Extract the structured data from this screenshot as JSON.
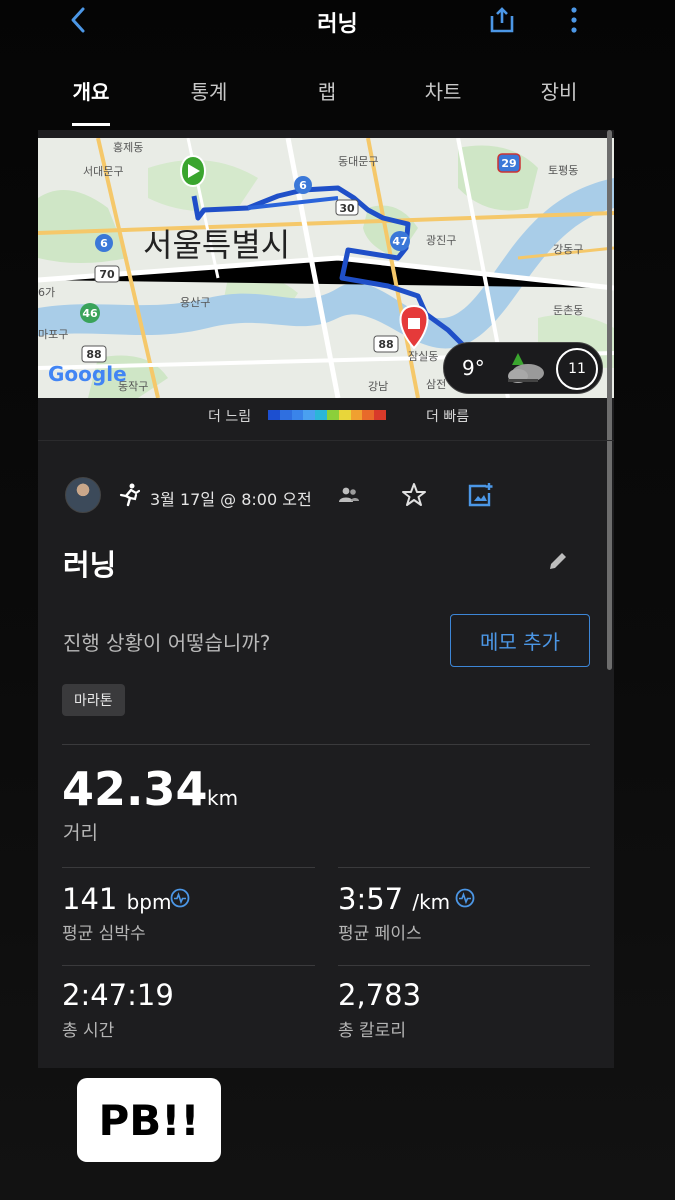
{
  "header": {
    "title": "러닝",
    "back_icon": "chevron-left-icon",
    "share_icon": "share-icon",
    "more_icon": "more-vertical-icon"
  },
  "tabs": [
    {
      "label": "개요",
      "active": true
    },
    {
      "label": "통계",
      "active": false
    },
    {
      "label": "랩",
      "active": false
    },
    {
      "label": "차트",
      "active": false
    },
    {
      "label": "장비",
      "active": false
    }
  ],
  "map": {
    "city_label": "서울특별시",
    "district_labels": [
      "홍제동",
      "서대문구",
      "동대문구",
      "광진구",
      "용산구",
      "잠실동",
      "강동구",
      "둔촌동",
      "토평동",
      "동작구",
      "삼전",
      "강남",
      "마포구",
      "6가"
    ],
    "route_markers": [
      "6",
      "30",
      "47",
      "6",
      "70",
      "46",
      "88",
      "88",
      "29"
    ],
    "provider": "Google",
    "weather": {
      "temperature": "9°",
      "wind": "11"
    }
  },
  "pace_legend": {
    "slow": "더 느림",
    "fast": "더 빠름",
    "colors": [
      "#1c4fd0",
      "#2f6fe0",
      "#3a84ea",
      "#4aa0f0",
      "#2bb6d8",
      "#8ccf3a",
      "#e8d63a",
      "#f0a030",
      "#e86a2a",
      "#d83a2a"
    ]
  },
  "activity": {
    "date": "3월 17일 @ 8:00 오전",
    "title": "러닝",
    "progress_question": "진행 상황이 어떻습니까?",
    "memo_button": "메모 추가",
    "tag": "마라톤"
  },
  "stats": {
    "distance": {
      "value": "42.34",
      "unit": "km",
      "label": "거리"
    },
    "heart_rate": {
      "value": "141",
      "unit": "bpm",
      "label": "평균 심박수"
    },
    "pace": {
      "value": "3:57",
      "unit": "/km",
      "label": "평균 페이스"
    },
    "time": {
      "value": "2:47:19",
      "label": "총 시간"
    },
    "calories": {
      "value": "2,783",
      "label": "총 칼로리"
    }
  },
  "overlay": {
    "badge": "PB!!"
  },
  "colors": {
    "accent": "#4c97e6",
    "route": "#1f4fc8",
    "panel": "#1d1d1f"
  }
}
